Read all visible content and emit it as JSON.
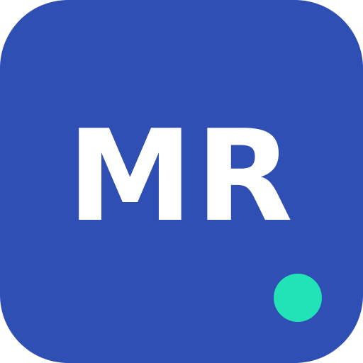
{
  "icon": {
    "initials": "MR",
    "background_color": "#304fb4",
    "text_color": "#ffffff",
    "status_color": "#22e3b5"
  }
}
